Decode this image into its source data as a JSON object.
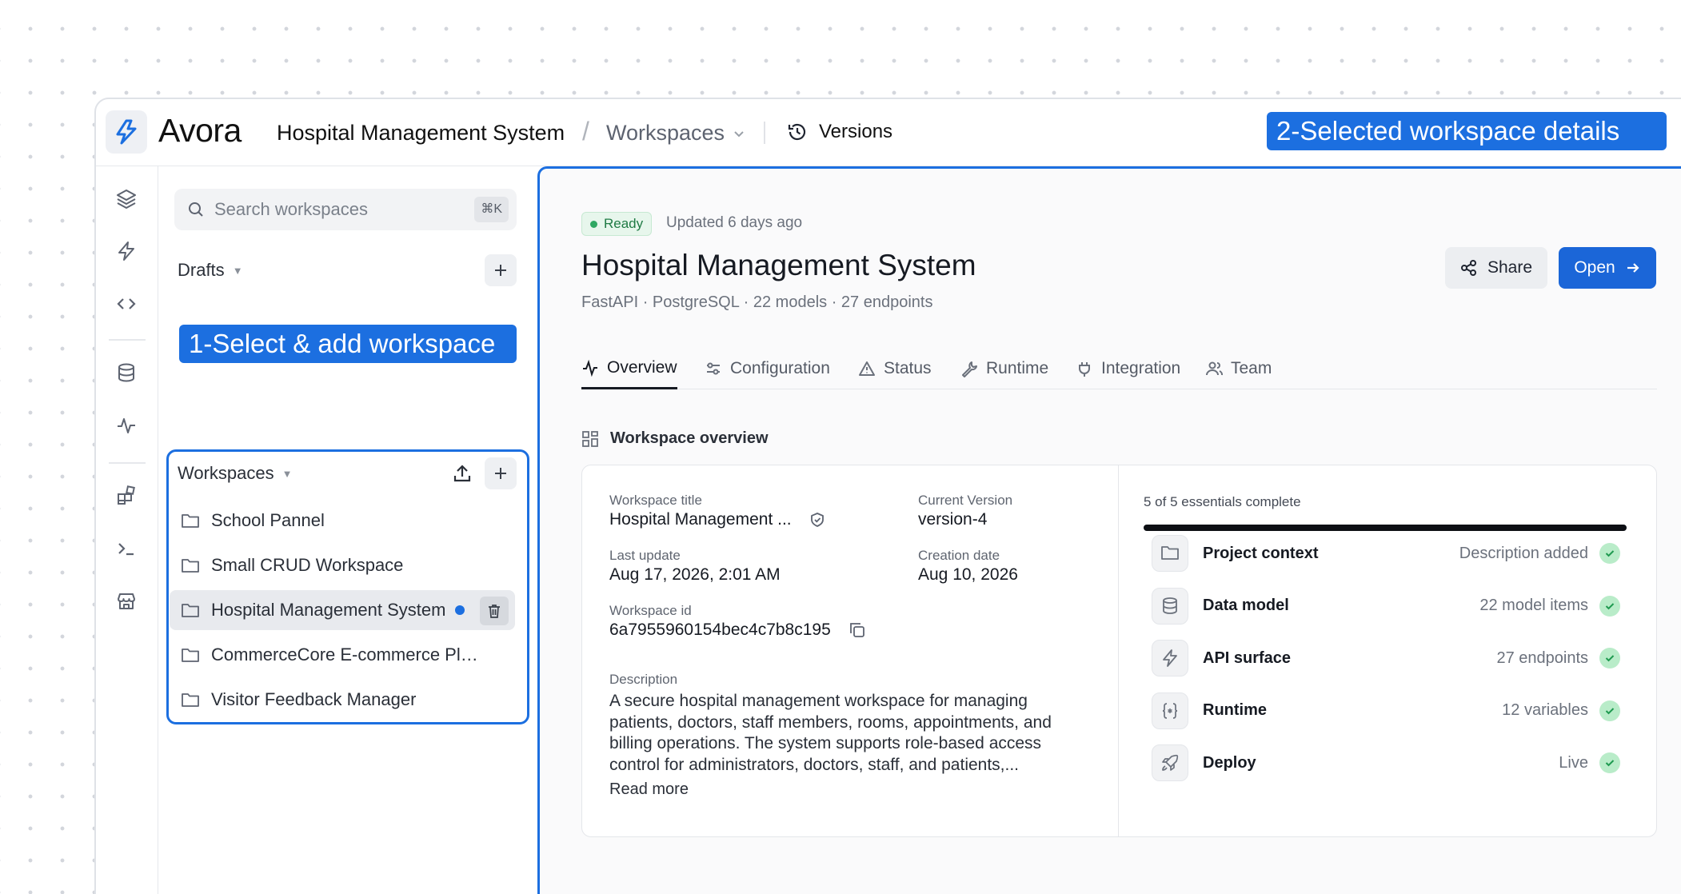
{
  "header": {
    "brand": "Avora",
    "breadcrumb_project": "Hospital Management System",
    "breadcrumb_separator": "/",
    "breadcrumb_section": "Workspaces",
    "versions_label": "Versions"
  },
  "annotations": {
    "left": "1-Select & add workspace",
    "right": "2-Selected workspace details"
  },
  "rail": {
    "icons": [
      "layers-icon",
      "bolt-icon",
      "code-icon",
      "database-icon",
      "activity-icon",
      "widgets-icon",
      "terminal-icon",
      "store-icon"
    ]
  },
  "sidebar": {
    "search_placeholder": "Search workspaces",
    "search_shortcut": "⌘K",
    "drafts_label": "Drafts",
    "workspaces_label": "Workspaces",
    "workspaces": [
      {
        "name": "School Pannel",
        "selected": false
      },
      {
        "name": "Small CRUD Workspace",
        "selected": false
      },
      {
        "name": "Hospital Management System",
        "selected": true
      },
      {
        "name": "CommerceCore E-commerce Pla...",
        "selected": false
      },
      {
        "name": "Visitor Feedback Manager",
        "selected": false
      }
    ]
  },
  "main": {
    "status_badge": "Ready",
    "updated": "Updated 6 days ago",
    "title": "Hospital Management System",
    "subtitle": "FastAPI · PostgreSQL · 22 models · 27 endpoints",
    "share_label": "Share",
    "open_label": "Open",
    "tabs": [
      {
        "label": "Overview",
        "icon": "activity-icon",
        "active": true
      },
      {
        "label": "Configuration",
        "icon": "sliders-icon",
        "active": false
      },
      {
        "label": "Status",
        "icon": "warning-icon",
        "active": false
      },
      {
        "label": "Runtime",
        "icon": "wrench-icon",
        "active": false
      },
      {
        "label": "Integration",
        "icon": "plug-icon",
        "active": false
      },
      {
        "label": "Team",
        "icon": "users-icon",
        "active": false
      }
    ],
    "overview_heading": "Workspace overview",
    "details": {
      "title_label": "Workspace title",
      "title_value": "Hospital Management ...",
      "version_label": "Current Version",
      "version_value": "version-4",
      "last_update_label": "Last update",
      "last_update_value": "Aug 17, 2026, 2:01 AM",
      "creation_label": "Creation date",
      "creation_value": "Aug 10, 2026",
      "id_label": "Workspace id",
      "id_value": "6a7955960154bec4c7b8c195",
      "description_label": "Description",
      "description": "A secure hospital management workspace for managing patients, doctors, staff members, rooms, appointments, and billing operations. The system supports role-based access control for administrators, doctors, staff, and patients,...",
      "read_more": "Read more"
    },
    "essentials": {
      "summary": "5 of 5 essentials complete",
      "completed": 5,
      "total": 5,
      "items": [
        {
          "name": "Project context",
          "status": "Description added",
          "icon": "folder-icon"
        },
        {
          "name": "Data model",
          "status": "22 model items",
          "icon": "database-icon"
        },
        {
          "name": "API surface",
          "status": "27 endpoints",
          "icon": "bolt-icon"
        },
        {
          "name": "Runtime",
          "status": "12 variables",
          "icon": "braces-icon"
        },
        {
          "name": "Deploy",
          "status": "Live",
          "icon": "rocket-icon"
        }
      ]
    }
  },
  "colors": {
    "accent": "#1c6fe0",
    "primary_button": "#1b66d8",
    "success": "#2fa862"
  }
}
